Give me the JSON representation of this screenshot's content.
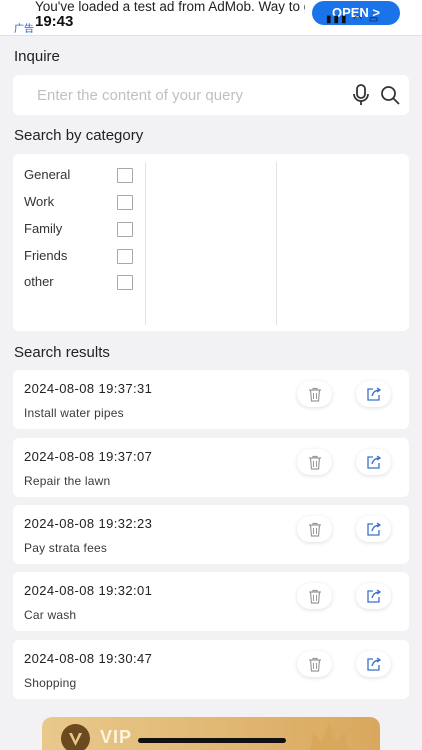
{
  "ad": {
    "text": "You've loaded a test ad from AdMob. Way to go!",
    "tag": "广告",
    "open_label": "OPEN >"
  },
  "status": {
    "time": "19:43",
    "icons": "▮▮▮ ◠ ▭"
  },
  "inquire": {
    "title": "Inquire",
    "placeholder": "Enter the content of your query"
  },
  "categories": {
    "title": "Search by category",
    "items": [
      {
        "label": "General",
        "checked": false
      },
      {
        "label": "Work",
        "checked": false
      },
      {
        "label": "Family",
        "checked": false
      },
      {
        "label": "Friends",
        "checked": false
      },
      {
        "label": "other",
        "checked": false
      }
    ]
  },
  "results": {
    "title": "Search results",
    "items": [
      {
        "datetime": "2024-08-08 19:37:31",
        "title": "Install water pipes"
      },
      {
        "datetime": "2024-08-08 19:37:07",
        "title": "Repair the lawn"
      },
      {
        "datetime": "2024-08-08 19:32:23",
        "title": "Pay strata fees"
      },
      {
        "datetime": "2024-08-08 19:32:01",
        "title": "Car wash"
      },
      {
        "datetime": "2024-08-08 19:30:47",
        "title": "Shopping"
      }
    ]
  },
  "vip": {
    "badge": "V",
    "label": "VIP"
  },
  "colors": {
    "background": "#f2f2f5",
    "ad_button": "#1a73e8",
    "vip_gold": "#e4bd7e"
  },
  "icons": {
    "mic": "microphone-icon",
    "search": "search-icon",
    "delete": "trash-icon",
    "share": "share-icon",
    "vip": "crown-icon"
  }
}
